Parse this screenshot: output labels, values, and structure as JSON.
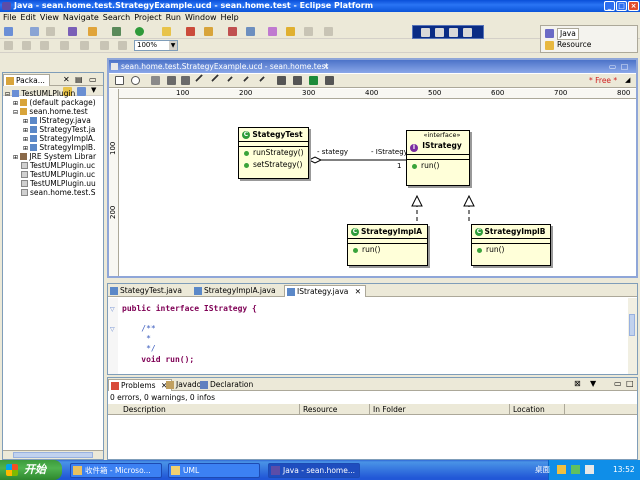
{
  "window": {
    "title": "Java - sean.home.test.StrategyExample.ucd - sean.home.test - Eclipse Platform"
  },
  "menu": [
    "File",
    "Edit",
    "View",
    "Navigate",
    "Search",
    "Project",
    "Run",
    "Window",
    "Help"
  ],
  "toolbar": {
    "zoom": "100%"
  },
  "perspective": {
    "java_label": "Java",
    "resource_label": "Resource"
  },
  "package_explorer": {
    "tab_label": "Packa...",
    "tree": [
      {
        "label": "TestUMLPlugin",
        "depth": 0,
        "icon": "project-icon"
      },
      {
        "label": "(default package)",
        "depth": 1,
        "icon": "package-icon"
      },
      {
        "label": "sean.home.test",
        "depth": 1,
        "icon": "package-icon"
      },
      {
        "label": "IStrategy.java",
        "depth": 2,
        "icon": "java-file-icon"
      },
      {
        "label": "StrategyTest.ja",
        "depth": 2,
        "icon": "java-file-icon"
      },
      {
        "label": "StrategyImplA.",
        "depth": 2,
        "icon": "java-file-icon"
      },
      {
        "label": "StrategyImplB.",
        "depth": 2,
        "icon": "java-file-icon"
      },
      {
        "label": "JRE System Librar",
        "depth": 1,
        "icon": "library-icon"
      },
      {
        "label": "TestUMLPlugin.uc",
        "depth": 1,
        "icon": "ucd-file-icon"
      },
      {
        "label": "TestUMLPlugin.uc",
        "depth": 1,
        "icon": "ucd-file-icon"
      },
      {
        "label": "TestUMLPlugin.uu",
        "depth": 1,
        "icon": "ucd-file-icon"
      },
      {
        "label": "sean.home.test.S",
        "depth": 1,
        "icon": "ucd-file-icon"
      }
    ]
  },
  "diagram_editor": {
    "tab_title": "sean.home.test.StrategyExample.ucd - sean.home.test",
    "free_label": "* Free *",
    "ruler_h": [
      "100",
      "200",
      "300",
      "400",
      "500",
      "600",
      "700",
      "800"
    ],
    "ruler_v": [
      "100",
      "200"
    ],
    "classes": {
      "strategy_test": {
        "name": "StategyTest",
        "ops": [
          "runStrategy()",
          "setStrategy()"
        ]
      },
      "istrategy": {
        "stereotype": "«interface»",
        "name": "IStrategy",
        "ops": [
          "run()"
        ]
      },
      "impl_a": {
        "name": "StrategyImplA",
        "ops": [
          "run()"
        ]
      },
      "impl_b": {
        "name": "StrategyImplB",
        "ops": [
          "run()"
        ]
      }
    },
    "assoc": {
      "left_role": "- stategy",
      "right_role": "- IStrategy",
      "multiplicity": "1"
    }
  },
  "source_editor": {
    "tabs": [
      "StategyTest.java",
      "StrategyImplA.java",
      "IStrategy.java"
    ],
    "lines": [
      "public interface IStrategy {",
      "",
      "    /**",
      "     *",
      "     */",
      "    void run();"
    ]
  },
  "problems": {
    "tabs": [
      "Problems",
      "Javadoc",
      "Declaration"
    ],
    "summary": "0 errors, 0 warnings, 0 infos",
    "columns": [
      "Description",
      "Resource",
      "In Folder",
      "Location"
    ]
  },
  "taskbar": {
    "start": "开始",
    "tasks": [
      "收件箱 - Microso...",
      "UML",
      "Java - sean.home..."
    ],
    "tray_text": "桌面",
    "clock": "13:52"
  }
}
